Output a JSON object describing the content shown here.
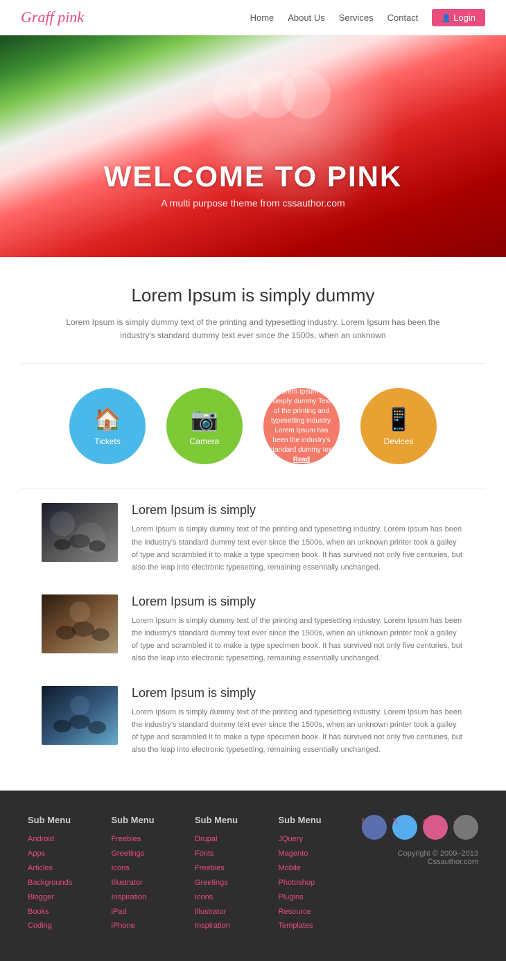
{
  "navbar": {
    "logo_main": "Graff",
    "logo_accent": "pink",
    "links": [
      {
        "label": "Home",
        "id": "home"
      },
      {
        "label": "About Us",
        "id": "about"
      },
      {
        "label": "Services",
        "id": "services"
      },
      {
        "label": "Contact",
        "id": "contact"
      }
    ],
    "login_label": "Login"
  },
  "hero": {
    "title": "WELCOME TO PINK",
    "subtitle": "A multi purpose theme from cssauthor.com"
  },
  "intro": {
    "heading": "Lorem Ipsum is simply dummy",
    "body": "Lorem Ipsum is simply dummy text of the printing and typesetting industry. Lorem Ipsum has been the industry's standard dummy text ever since the 1500s, when an unknown"
  },
  "icon_circles": [
    {
      "label": "Tickets",
      "color": "blue",
      "icon": "🏠"
    },
    {
      "label": "Camera",
      "color": "green",
      "icon": "📷"
    },
    {
      "label": "pink_text",
      "color": "pink",
      "body": "Lorem Ipsum is simply dummy Text of the printing and typesetting industry. Lorem Ipsum has been the industry's standard dummy text",
      "link": "Read"
    },
    {
      "label": "Devices",
      "color": "orange",
      "icon": "📱"
    }
  ],
  "content_rows": [
    {
      "id": "row1",
      "title": "Lorem Ipsum is simply",
      "body": "Lorem Ipsum is simply dummy text of the printing and typesetting industry. Lorem Ipsum has been the industry's standard dummy text ever since the 1500s, when an unknown printer took a galley of type and scrambled it to make a type specimen book. It has survived not only five centuries, but also the leap into electronic typesetting, remaining essentially unchanged.",
      "img_class": "img-1"
    },
    {
      "id": "row2",
      "title": "Lorem Ipsum is simply",
      "body": "Lorem Ipsum is simply dummy text of the printing and typesetting industry. Lorem Ipsum has been the industry's standard dummy text ever since the 1500s, when an unknown printer took a galley of type and scrambled it to make a type specimen book. It has survived not only five centuries, but also the leap into electronic typesetting, remaining essentially unchanged.",
      "img_class": "img-2"
    },
    {
      "id": "row3",
      "title": "Lorem Ipsum is simply",
      "body": "Lorem Ipsum is simply dummy text of the printing and typesetting industry. Lorem Ipsum has been the industry's standard dummy text ever since the 1500s, when an unknown printer took a galley of type and scrambled it to make a type specimen book. It has survived not only five centuries, but also the leap into electronic typesetting, remaining essentially unchanged.",
      "img_class": "img-3"
    }
  ],
  "footer": {
    "cols": [
      {
        "heading": "Sub Menu",
        "links": [
          "Android",
          "Apps",
          "Articles",
          "Backgrounds",
          "Blogger",
          "Books",
          "Coding"
        ]
      },
      {
        "heading": "Sub Menu",
        "links": [
          "Freebies",
          "Greetings",
          "Icons",
          "Illustrator",
          "Inspiration",
          "iPad",
          "iPhone"
        ]
      },
      {
        "heading": "Sub Menu",
        "links": [
          "Drupal",
          "Fonts",
          "Freebies",
          "Greetings",
          "Icons",
          "Illustrator",
          "Inspiration"
        ]
      },
      {
        "heading": "Sub Menu",
        "links": [
          "JQuery",
          "Magento",
          "Mobile",
          "Photoshop",
          "Plugins",
          "Resource",
          "Templates"
        ]
      }
    ],
    "social": [
      {
        "name": "facebook",
        "icon": "f"
      },
      {
        "name": "twitter",
        "icon": "t"
      },
      {
        "name": "dribbble",
        "icon": "d"
      },
      {
        "name": "share",
        "icon": "s"
      }
    ],
    "copyright": "Copyright © 2009–2013 Cssauthor.com"
  }
}
